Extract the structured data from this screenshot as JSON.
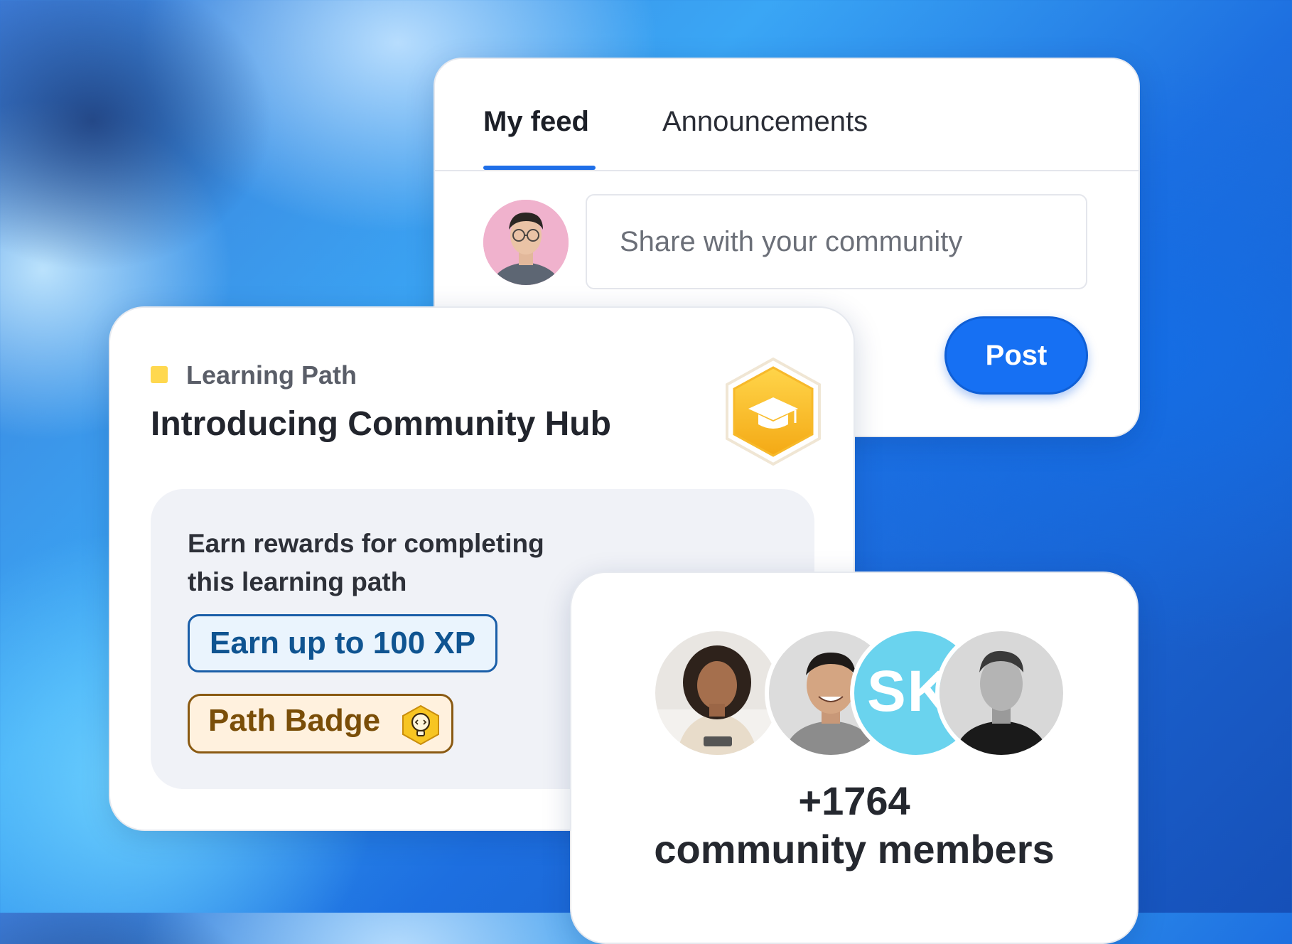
{
  "feed": {
    "tabs": [
      {
        "label": "My feed",
        "active": true
      },
      {
        "label": "Announcements",
        "active": false
      }
    ],
    "share_placeholder": "Share with your community",
    "post_label": "Post"
  },
  "learning": {
    "category": "Learning Path",
    "title": "Introducing Community Hub",
    "badge_icon": "graduation-cap-icon",
    "rewards_text": "Earn rewards for completing this learning path",
    "xp_label": "Earn up to 100 XP",
    "path_badge_label": "Path Badge",
    "path_badge_icon": "lightbulb-code-icon"
  },
  "members": {
    "initials": "SK",
    "count": "+1764",
    "label": "community members"
  },
  "colors": {
    "accent": "#1670f3",
    "tab_underline": "#1f6fe8",
    "badge_gold": "#f5b41a",
    "initials_avatar": "#6ad3ee"
  }
}
